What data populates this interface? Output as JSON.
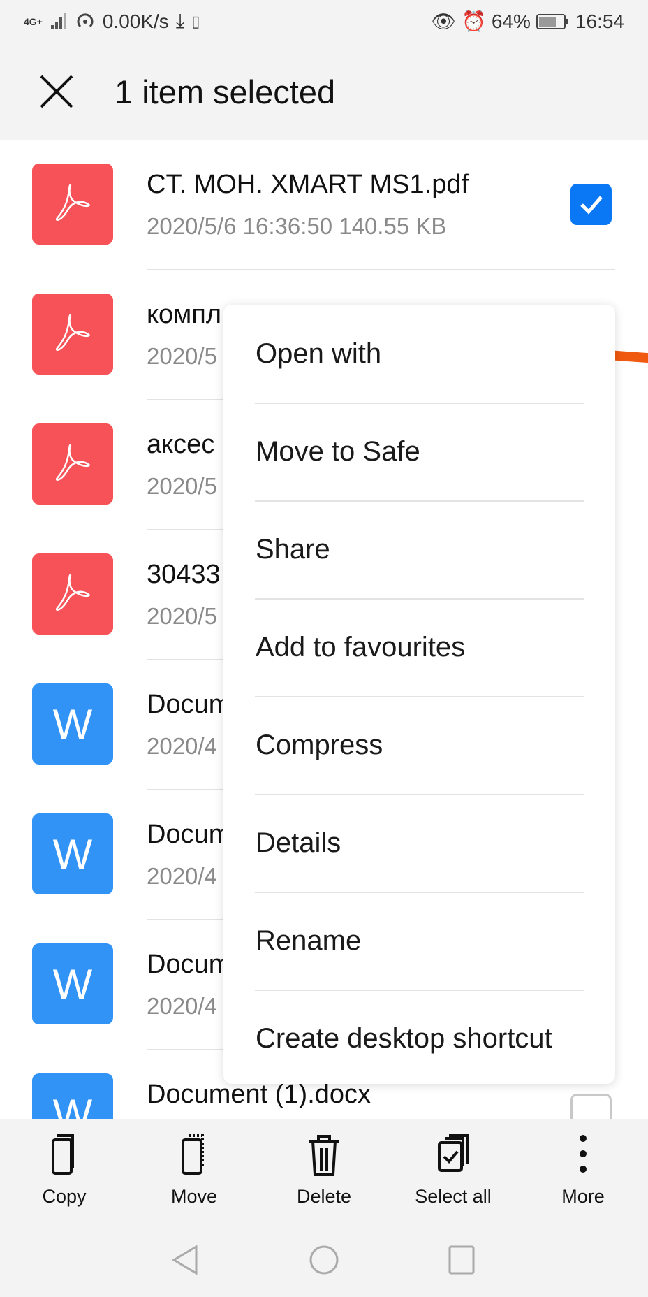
{
  "status_bar": {
    "network": "4G+",
    "speed": "0.00K/s",
    "battery": "64%",
    "time": "16:54"
  },
  "header": {
    "title": "1 item selected"
  },
  "files": [
    {
      "name": "CT. MOH. XMART MS1.pdf",
      "meta": "2020/5/6 16:36:50 140.55 KB",
      "type": "pdf",
      "checked": true
    },
    {
      "name": "компл",
      "meta": "2020/5",
      "type": "pdf",
      "checked": false
    },
    {
      "name": "аксес",
      "meta": "2020/5",
      "type": "pdf",
      "checked": false
    },
    {
      "name": "30433",
      "meta": "2020/5",
      "type": "pdf",
      "checked": false
    },
    {
      "name": "Docum",
      "meta": "2020/4",
      "type": "doc",
      "checked": false
    },
    {
      "name": "Docum",
      "meta": "2020/4",
      "type": "doc",
      "checked": false
    },
    {
      "name": "Docum",
      "meta": "2020/4",
      "type": "doc",
      "checked": false
    },
    {
      "name": "Document (1).docx",
      "meta": "",
      "type": "doc",
      "checked": false
    }
  ],
  "doc_icon_letter": "W",
  "context_menu": [
    "Open with",
    "Move to Safe",
    "Share",
    "Add to favourites",
    "Compress",
    "Details",
    "Rename",
    "Create desktop shortcut"
  ],
  "bottom_bar": [
    {
      "label": "Copy",
      "icon": "copy-icon"
    },
    {
      "label": "Move",
      "icon": "move-icon"
    },
    {
      "label": "Delete",
      "icon": "trash-icon"
    },
    {
      "label": "Select all",
      "icon": "select-all-icon"
    },
    {
      "label": "More",
      "icon": "more-vertical-icon"
    }
  ],
  "colors": {
    "pdf": "#f65257",
    "doc": "#3193f5",
    "checkbox": "#0a78f5",
    "annotation": "#f05a10"
  }
}
